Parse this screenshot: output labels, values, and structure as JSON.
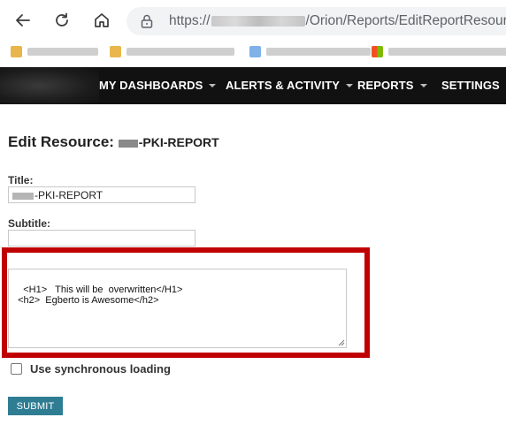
{
  "browser": {
    "url_prefix": "https://",
    "url_suffix": "/Orion/Reports/EditReportResource.as"
  },
  "nav": {
    "items": [
      {
        "label": "MY DASHBOARDS"
      },
      {
        "label": "ALERTS & ACTIVITY"
      },
      {
        "label": "REPORTS"
      },
      {
        "label": "SETTINGS"
      }
    ]
  },
  "page": {
    "title_prefix": "Edit Resource: ",
    "title_name": "-PKI-REPORT"
  },
  "form": {
    "title_label": "Title:",
    "title_value": "-PKI-REPORT",
    "subtitle_label": "Subtitle:",
    "subtitle_value": "",
    "textarea_value": "<H1>   This will be  overwritten</H1>\n  <h2>  Egberto is Awesome</h2>",
    "sync_label": "Use synchronous loading",
    "sync_checked": false,
    "submit_label": "SUBMIT"
  },
  "colors": {
    "nav_bg": "#111111",
    "highlight": "#c00000",
    "submit_bg": "#2f7d93"
  }
}
